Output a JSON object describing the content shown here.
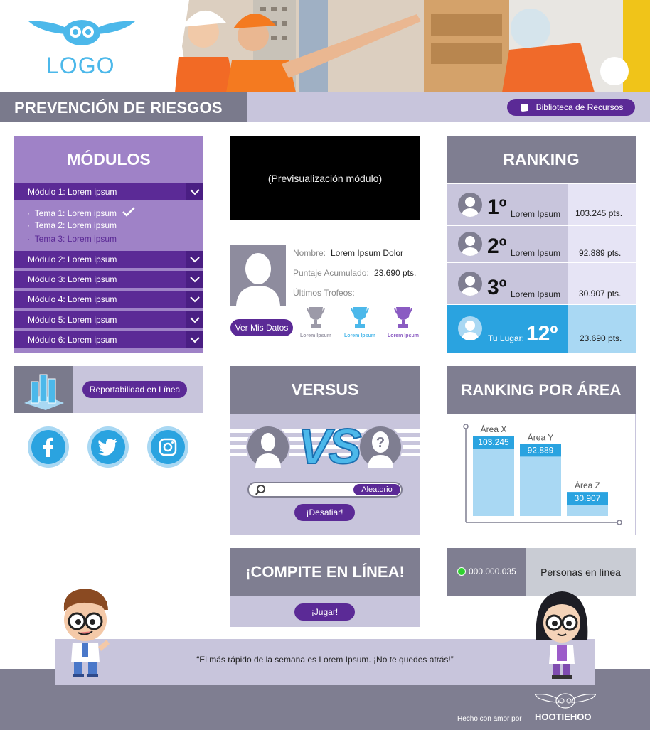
{
  "header": {
    "logo_text": "LOGO",
    "page_title": "PREVENCIÓN DE RIESGOS",
    "resources_button": "Biblioteca de Recursos"
  },
  "modules": {
    "title": "MÓDULOS",
    "items": [
      {
        "label": "Módulo 1: Lorem ipsum"
      },
      {
        "label": "Módulo 2: Lorem ipsum"
      },
      {
        "label": "Módulo 3: Lorem ipsum"
      },
      {
        "label": "Módulo 4: Lorem ipsum"
      },
      {
        "label": "Módulo 5: Lorem ipsum"
      },
      {
        "label": "Módulo 6: Lorem ipsum"
      }
    ],
    "topics": [
      {
        "label": "Tema 1: Lorem ipsum",
        "completed": true
      },
      {
        "label": "Tema 2: Lorem ipsum",
        "completed": false
      },
      {
        "label": "Tema 3: Lorem ipsum",
        "completed": false
      }
    ]
  },
  "preview": {
    "text": "(Previsualización módulo)"
  },
  "profile": {
    "name_label": "Nombre:",
    "name_value": "Lorem Ipsum Dolor",
    "score_label": "Puntaje Acumulado:",
    "score_value": "23.690 pts.",
    "trophies_label": "Últimos Trofeos:",
    "my_data_button": "Ver Mis Datos",
    "trophies": [
      {
        "label": "Lorem Ipsum",
        "color": "#9c9aa8"
      },
      {
        "label": "Lorem Ipsum",
        "color": "#4cb8ea"
      },
      {
        "label": "Lorem Ipsum",
        "color": "#8a5bc2"
      }
    ]
  },
  "ranking": {
    "title": "RANKING",
    "entries": [
      {
        "place": "1º",
        "name": "Lorem Ipsum",
        "points": "103.245 pts."
      },
      {
        "place": "2º",
        "name": "Lorem Ipsum",
        "points": "92.889 pts."
      },
      {
        "place": "3º",
        "name": "Lorem Ipsum",
        "points": "30.907 pts."
      }
    ],
    "user": {
      "label": "Tu Lugar:",
      "place": "12º",
      "points": "23.690 pts."
    }
  },
  "report": {
    "button": "Reportabilidad en Línea"
  },
  "social": [
    {
      "icon": "facebook-icon",
      "glyph": "f"
    },
    {
      "icon": "twitter-icon",
      "glyph": "t"
    },
    {
      "icon": "instagram-icon",
      "glyph": "i"
    }
  ],
  "versus": {
    "title": "VERSUS",
    "vs_text": "VS",
    "random_button": "Aleatorio",
    "challenge_button": "¡Desafiar!"
  },
  "area_ranking": {
    "title": "RANKING POR ÁREA",
    "chart_data": {
      "type": "bar",
      "categories": [
        "Área X",
        "Área Y",
        "Área Z"
      ],
      "values": [
        103245,
        92889,
        30907
      ],
      "value_labels": [
        "103.245",
        "92.889",
        "30.907"
      ],
      "bar_color": "#a9d8f3",
      "label_color": "#2aa3e0"
    }
  },
  "compete": {
    "title": "¡COMPITE EN LÍNEA!",
    "play_button": "¡Jugar!"
  },
  "online": {
    "count": "000.000.035",
    "label": "Personas en línea",
    "status_color": "#2fd12f"
  },
  "quote": {
    "text": "“El más rápido de la semana es Lorem Ipsum. ¡No te quedes atrás!”"
  },
  "footer": {
    "made_with": "Hecho con amor por",
    "brand": "HOOTIEHOO"
  }
}
